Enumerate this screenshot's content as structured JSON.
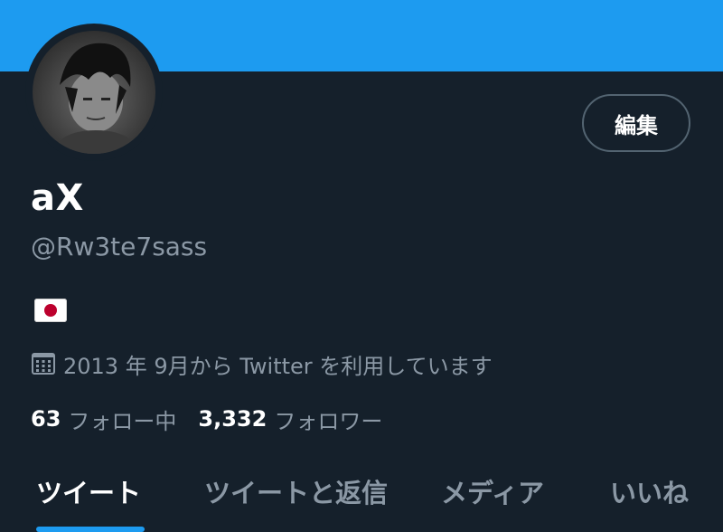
{
  "banner": {
    "color": "#1d9bf0"
  },
  "profile": {
    "display_name": "aX",
    "handle": "@Rw3te7sass",
    "bio_flag_icon": "japan-flag-icon",
    "joined_text": "2013 年 9月から Twitter を利用しています",
    "following_count": "63",
    "following_label": "フォロー中",
    "followers_count": "3,332",
    "followers_label": "フォロワー"
  },
  "actions": {
    "edit_label": "編集"
  },
  "tabs": [
    {
      "label": "ツイート",
      "active": true
    },
    {
      "label": "ツイートと返信",
      "active": false
    },
    {
      "label": "メディア",
      "active": false
    },
    {
      "label": "いいね",
      "active": false
    }
  ],
  "colors": {
    "background": "#15202b",
    "accent": "#1d9bf0",
    "muted_text": "#8b98a5",
    "border": "#536471"
  }
}
